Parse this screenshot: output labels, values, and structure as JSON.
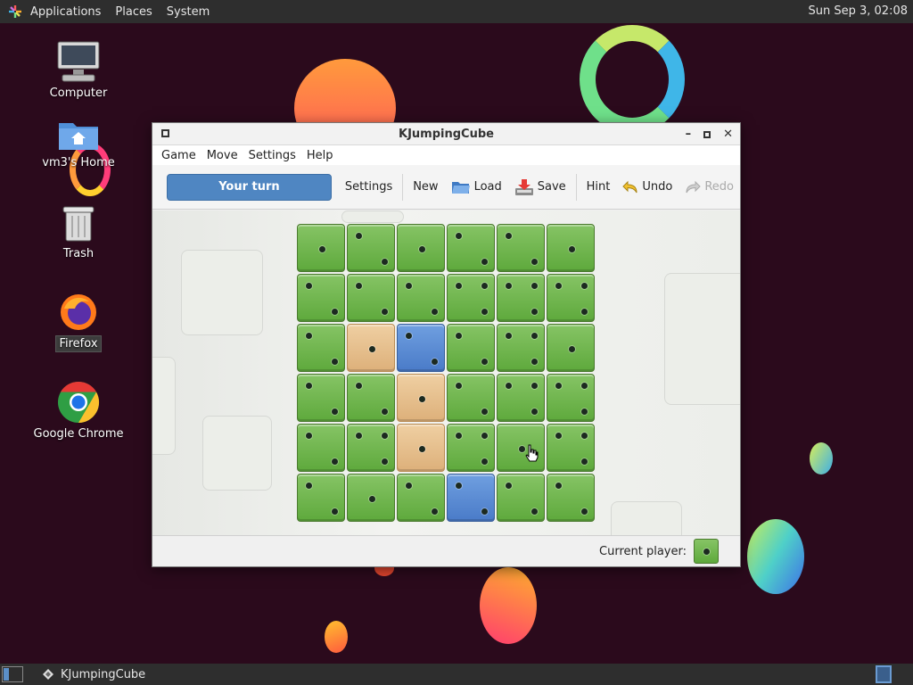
{
  "top_panel": {
    "menus": [
      "Applications",
      "Places",
      "System"
    ],
    "clock": "Sun Sep  3, 02:08"
  },
  "desktop": {
    "icons": [
      {
        "label": "Computer",
        "icon": "computer-icon"
      },
      {
        "label": "vm3's Home",
        "icon": "home-folder-icon"
      },
      {
        "label": "Trash",
        "icon": "trash-icon"
      },
      {
        "label": "Firefox",
        "icon": "firefox-icon"
      },
      {
        "label": "Google Chrome",
        "icon": "chrome-icon"
      }
    ]
  },
  "window": {
    "title": "KJumpingCube",
    "menu": [
      "Game",
      "Move",
      "Settings",
      "Help"
    ],
    "toolbar": {
      "turn_label": "Your turn",
      "settings": "Settings",
      "new": "New",
      "load": "Load",
      "save": "Save",
      "hint": "Hint",
      "undo": "Undo",
      "redo": "Redo"
    },
    "board": {
      "rows": [
        [
          {
            "c": "green",
            "n": 1
          },
          {
            "c": "green",
            "n": 2
          },
          {
            "c": "green",
            "n": 1
          },
          {
            "c": "green",
            "n": 2
          },
          {
            "c": "green",
            "n": 2
          },
          {
            "c": "green",
            "n": 1
          }
        ],
        [
          {
            "c": "green",
            "n": 2
          },
          {
            "c": "green",
            "n": 2
          },
          {
            "c": "green",
            "n": 2
          },
          {
            "c": "green",
            "n": 3
          },
          {
            "c": "green",
            "n": 3
          },
          {
            "c": "green",
            "n": 3
          }
        ],
        [
          {
            "c": "green",
            "n": 2
          },
          {
            "c": "tan",
            "n": 1
          },
          {
            "c": "blue",
            "n": 2
          },
          {
            "c": "green",
            "n": 2
          },
          {
            "c": "green",
            "n": 3
          },
          {
            "c": "green",
            "n": 1
          }
        ],
        [
          {
            "c": "green",
            "n": 2
          },
          {
            "c": "green",
            "n": 2
          },
          {
            "c": "tan",
            "n": 1
          },
          {
            "c": "green",
            "n": 2
          },
          {
            "c": "green",
            "n": 3
          },
          {
            "c": "green",
            "n": 3
          }
        ],
        [
          {
            "c": "green",
            "n": 2
          },
          {
            "c": "green",
            "n": 3
          },
          {
            "c": "tan",
            "n": 1
          },
          {
            "c": "green",
            "n": 3
          },
          {
            "c": "green",
            "n": 1
          },
          {
            "c": "green",
            "n": 3
          }
        ],
        [
          {
            "c": "green",
            "n": 2
          },
          {
            "c": "green",
            "n": 1
          },
          {
            "c": "green",
            "n": 2
          },
          {
            "c": "blue",
            "n": 2
          },
          {
            "c": "green",
            "n": 2
          },
          {
            "c": "green",
            "n": 2
          }
        ]
      ]
    },
    "status": {
      "current_player_label": "Current player:",
      "current_player_color": "#6fb64e"
    }
  },
  "taskbar": {
    "task_label": "KJumpingCube"
  },
  "colors": {
    "green": "#6fb64e",
    "tan": "#e5c08e",
    "blue": "#5b8dd4",
    "turn_button": "#4f86c2"
  }
}
